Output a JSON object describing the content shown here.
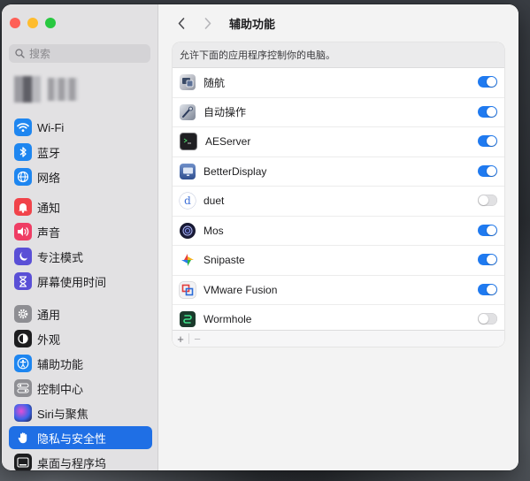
{
  "search": {
    "placeholder": "搜索"
  },
  "sidebar": {
    "group1": [
      {
        "label": "Wi-Fi",
        "icon": "wifi-icon",
        "color": "#1e86f0"
      },
      {
        "label": "蓝牙",
        "icon": "bluetooth-icon",
        "color": "#1e86f0"
      },
      {
        "label": "网络",
        "icon": "globe-icon",
        "color": "#1e86f0"
      }
    ],
    "group2": [
      {
        "label": "通知",
        "icon": "bell-icon",
        "color": "#f1434a"
      },
      {
        "label": "声音",
        "icon": "speaker-icon",
        "color": "#ef3d64"
      },
      {
        "label": "专注模式",
        "icon": "moon-icon",
        "color": "#5a4fd6"
      },
      {
        "label": "屏幕使用时间",
        "icon": "hourglass-icon",
        "color": "#5a4fd6"
      }
    ],
    "group3": [
      {
        "label": "通用",
        "icon": "gear-icon",
        "color": "#8e8e93"
      },
      {
        "label": "外观",
        "icon": "appearance-icon",
        "color": "#1d1d1f"
      },
      {
        "label": "辅助功能",
        "icon": "accessibility-icon",
        "color": "#1e86f0"
      },
      {
        "label": "控制中心",
        "icon": "control-center-icon",
        "color": "#8e8e93"
      },
      {
        "label": "Siri与聚焦",
        "icon": "siri-icon",
        "color": "#3b3b6e"
      },
      {
        "label": "隐私与安全性",
        "icon": "hand-icon",
        "color": "#1e86f0",
        "selected": true
      },
      {
        "label": "桌面与程序坞",
        "icon": "dock-icon",
        "color": "#1d1d1f"
      }
    ]
  },
  "header": {
    "title": "辅助功能"
  },
  "panel": {
    "description": "允许下面的应用程序控制你的电脑。",
    "apps": [
      {
        "name": "随航",
        "icon": "sidecar-icon",
        "enabled": true
      },
      {
        "name": "自动操作",
        "icon": "automator-icon",
        "enabled": true
      },
      {
        "name": "AEServer",
        "icon": "terminal-icon",
        "enabled": true
      },
      {
        "name": "BetterDisplay",
        "icon": "betterdisplay-icon",
        "enabled": true
      },
      {
        "name": "duet",
        "icon": "duet-icon",
        "enabled": false
      },
      {
        "name": "Mos",
        "icon": "mos-icon",
        "enabled": true
      },
      {
        "name": "Snipaste",
        "icon": "snipaste-icon",
        "enabled": true
      },
      {
        "name": "VMware Fusion",
        "icon": "vmware-icon",
        "enabled": true
      },
      {
        "name": "Wormhole",
        "icon": "wormhole-icon",
        "enabled": false
      }
    ],
    "add_label": "+",
    "remove_label": "−"
  }
}
